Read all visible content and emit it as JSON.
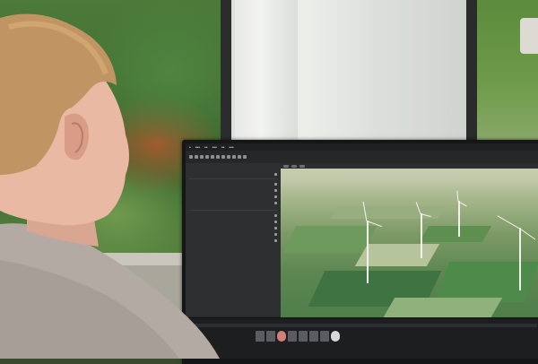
{
  "scene": {
    "description_icons": {
      "app": "3d-editor-window",
      "person": "person-silhouette"
    }
  },
  "colors": {
    "screen_bg": "#2a2b2d",
    "panel_bg": "#2e2f31",
    "foliage": "#4c7a3a",
    "skin": "#e9b9a3",
    "hair": "#c09563",
    "shirt": "#b3aaa3"
  }
}
